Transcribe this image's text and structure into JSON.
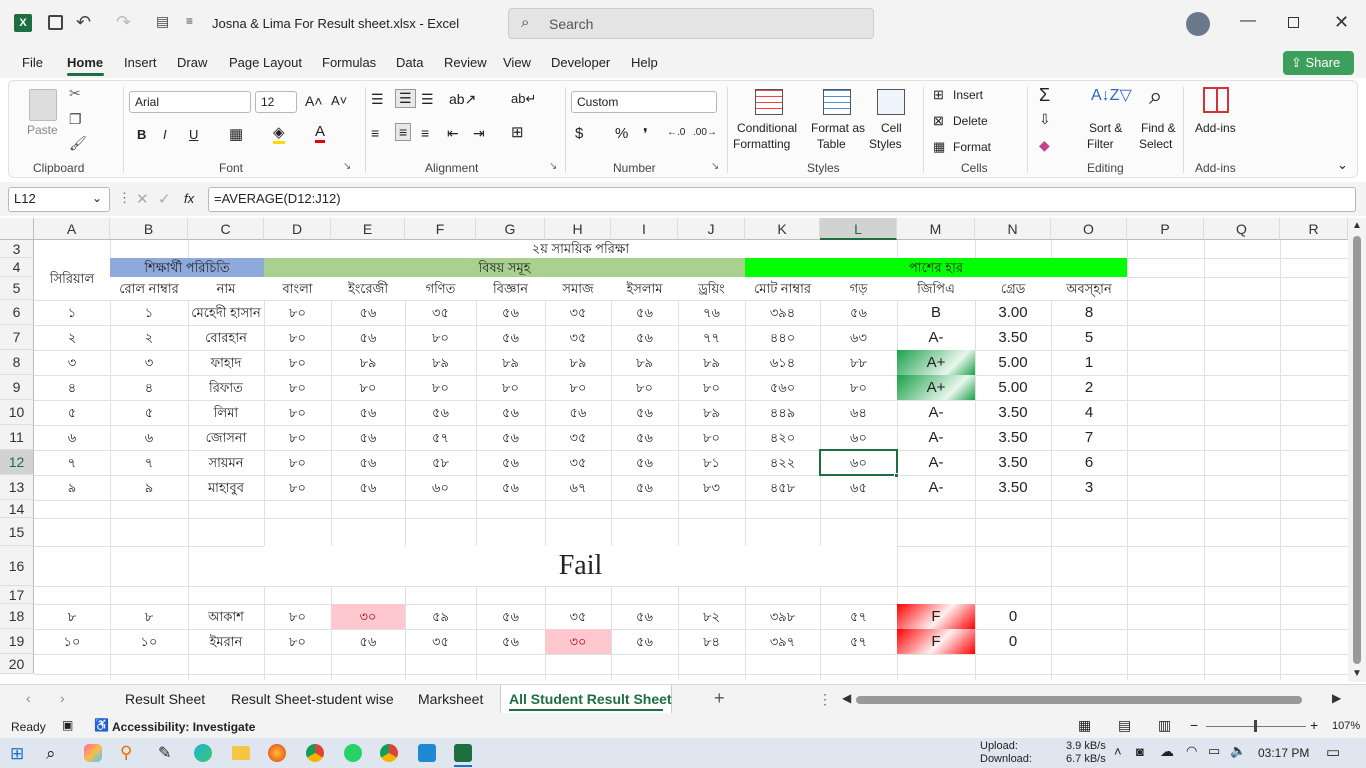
{
  "window": {
    "title": "Josna & Lima For Result sheet.xlsx  -  Excel",
    "search_placeholder": "Search"
  },
  "menu": [
    "File",
    "Home",
    "Insert",
    "Draw",
    "Page Layout",
    "Formulas",
    "Data",
    "Review",
    "View",
    "Developer",
    "Help"
  ],
  "share_label": "Share",
  "ribbon": {
    "clipboard": {
      "paste": "Paste",
      "label": "Clipboard"
    },
    "font": {
      "name": "Arial",
      "size": "12",
      "label": "Font",
      "bold": "B",
      "italic": "I",
      "underline": "U"
    },
    "alignment": {
      "label": "Alignment"
    },
    "number": {
      "format": "Custom",
      "label": "Number"
    },
    "styles": {
      "conditional": "Conditional",
      "conditional2": "Formatting",
      "format_as": "Format as",
      "format_as2": "Table",
      "cell_styles": "Cell",
      "cell_styles2": "Styles",
      "label": "Styles"
    },
    "cells": {
      "insert": "Insert",
      "delete": "Delete",
      "format": "Format",
      "label": "Cells"
    },
    "editing": {
      "sort": "Sort &",
      "sort2": "Filter",
      "find": "Find &",
      "find2": "Select",
      "label": "Editing"
    },
    "addins": {
      "name": "Add-ins",
      "label": "Add-ins"
    }
  },
  "formula_bar": {
    "name_box": "L12",
    "formula": "=AVERAGE(D12:J12)",
    "fx": "fx"
  },
  "columns": [
    "A",
    "B",
    "C",
    "D",
    "E",
    "F",
    "G",
    "H",
    "I",
    "J",
    "K",
    "L",
    "M",
    "N",
    "O",
    "P",
    "Q",
    "R"
  ],
  "rows_visible": [
    "3",
    "4",
    "5",
    "6",
    "7",
    "8",
    "9",
    "10",
    "11",
    "12",
    "13",
    "14",
    "15",
    "16",
    "17",
    "18",
    "19",
    "20"
  ],
  "sheet": {
    "title": "২য় সাময়িক পরিক্ষা",
    "serial_header": "সিরিয়াল",
    "student_info": "শিক্ষার্থী পরিচিতি",
    "subjects": "বিষয় সমূহ",
    "pass_rate": "পাশের হার",
    "headers": [
      "রোল নাম্বার",
      "নাম",
      "বাংলা",
      "ইংরেজী",
      "গণিত",
      "বিজ্ঞান",
      "সমাজ",
      "ইসলাম",
      "ড্রয়িং",
      "মোট নাম্বার",
      "গড়",
      "জিপিএ",
      "গ্রেড",
      "অবস্হান"
    ],
    "rows": [
      [
        "১",
        "১",
        "মেহেদী হাসান",
        "৮০",
        "৫৬",
        "৩৫",
        "৫৬",
        "৩৫",
        "৫৬",
        "৭৬",
        "৩৯৪",
        "৫৬",
        "B",
        "3.00",
        "8"
      ],
      [
        "২",
        "২",
        "বোরহান",
        "৮০",
        "৫৬",
        "৮০",
        "৫৬",
        "৩৫",
        "৫৬",
        "৭৭",
        "৪৪০",
        "৬৩",
        "A-",
        "3.50",
        "5"
      ],
      [
        "৩",
        "৩",
        "ফাহাদ",
        "৮০",
        "৮৯",
        "৮৯",
        "৮৯",
        "৮৯",
        "৮৯",
        "৮৯",
        "৬১৪",
        "৮৮",
        "A+",
        "5.00",
        "1"
      ],
      [
        "৪",
        "৪",
        "রিফাত",
        "৮০",
        "৮০",
        "৮০",
        "৮০",
        "৮০",
        "৮০",
        "৮০",
        "৫৬০",
        "৮০",
        "A+",
        "5.00",
        "2"
      ],
      [
        "৫",
        "৫",
        "লিমা",
        "৮০",
        "৫৬",
        "৫৬",
        "৫৬",
        "৫৬",
        "৫৬",
        "৮৯",
        "৪৪৯",
        "৬৪",
        "A-",
        "3.50",
        "4"
      ],
      [
        "৬",
        "৬",
        "জোসনা",
        "৮০",
        "৫৬",
        "৫৭",
        "৫৬",
        "৩৫",
        "৫৬",
        "৮০",
        "৪২০",
        "৬০",
        "A-",
        "3.50",
        "7"
      ],
      [
        "৭",
        "৭",
        "সায়মন",
        "৮০",
        "৫৬",
        "৫৮",
        "৫৬",
        "৩৫",
        "৫৬",
        "৮১",
        "৪২২",
        "৬০",
        "A-",
        "3.50",
        "6"
      ],
      [
        "৯",
        "৯",
        "মাহাবুব",
        "৮০",
        "৫৬",
        "৬০",
        "৫৬",
        "৬৭",
        "৫৬",
        "৮৩",
        "৪৫৮",
        "৬৫",
        "A-",
        "3.50",
        "3"
      ]
    ],
    "fail_title": "Fail",
    "fail_rows": [
      [
        "৮",
        "৮",
        "আকাশ",
        "৮০",
        "৩০",
        "৫৯",
        "৫৬",
        "৩৫",
        "৫৬",
        "৮২",
        "৩৯৮",
        "৫৭",
        "F",
        "0"
      ],
      [
        "১০",
        "১০",
        "ইমরান",
        "৮০",
        "৫৬",
        "৩৫",
        "৫৬",
        "৩০",
        "৫৬",
        "৮৪",
        "৩৯৭",
        "৫৭",
        "F",
        "0"
      ]
    ]
  },
  "tabs": [
    "Result Sheet",
    "Result Sheet-student wise",
    "Marksheet",
    "All Student Result Sheet"
  ],
  "status": {
    "ready": "Ready",
    "accessibility": "Accessibility: Investigate",
    "zoom": "107%"
  },
  "taskbar": {
    "upload_label": "Upload:",
    "download_label": "Download:",
    "upload": "3.9 kB/s",
    "download": "6.7 kB/s",
    "time": "03:17 PM"
  },
  "colors": {
    "blue_header": "#8eaadb",
    "green_header": "#a9d08e",
    "bright_green": "#00ff00",
    "pink": "#ffc7ce",
    "excel_green": "#217346",
    "red": "#ff0000"
  }
}
